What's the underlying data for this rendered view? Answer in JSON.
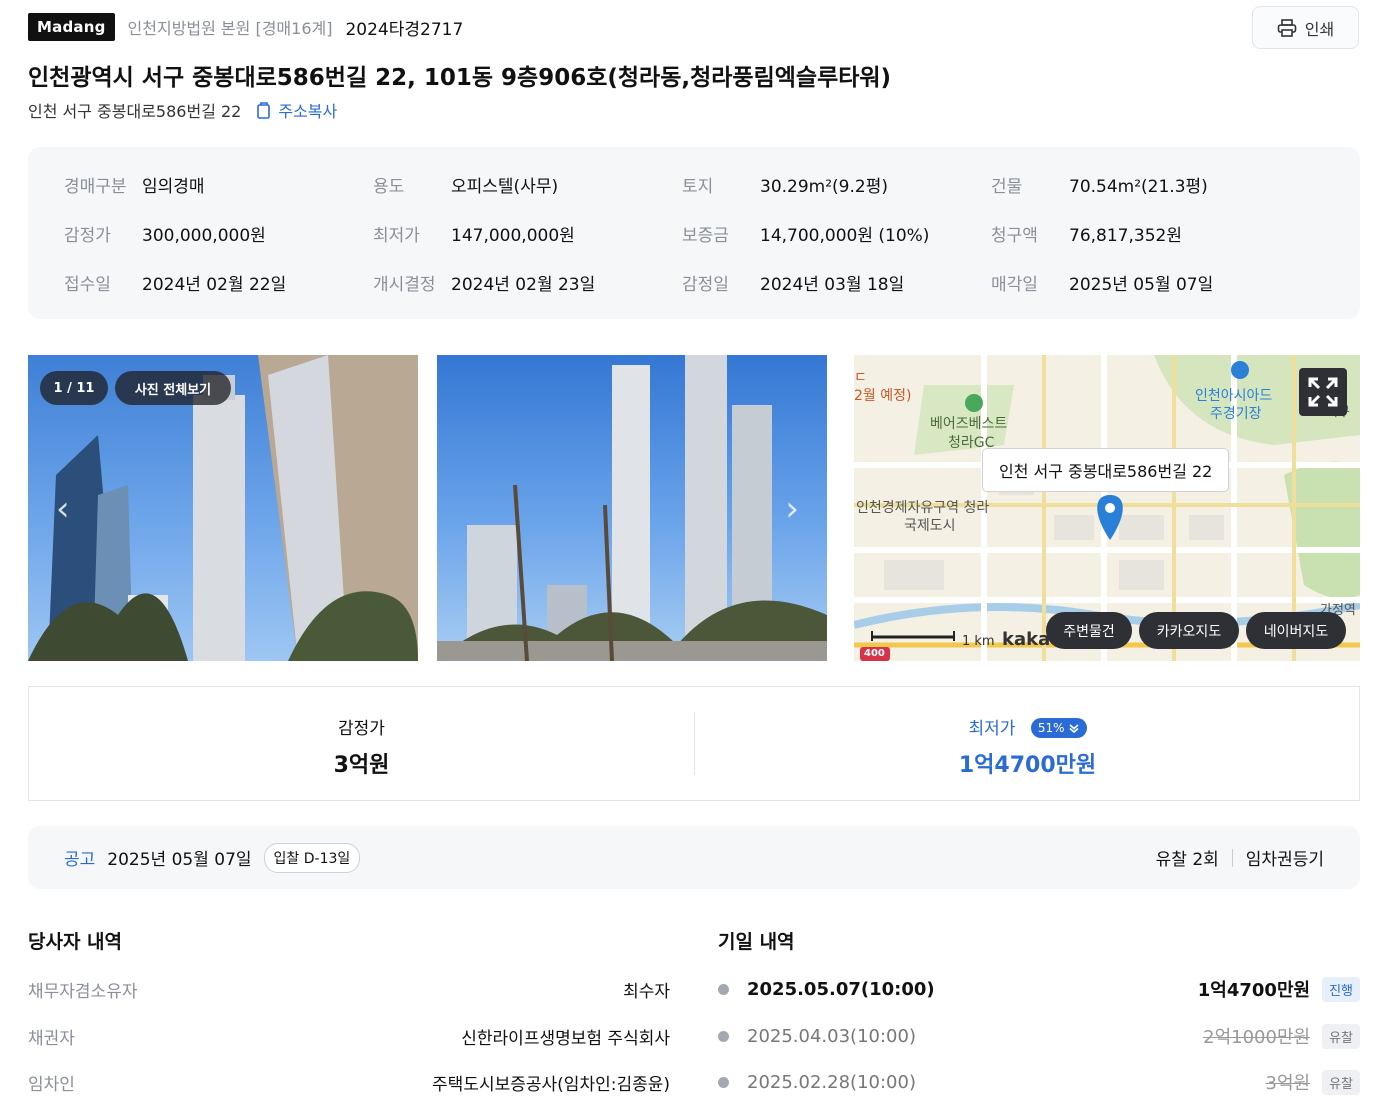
{
  "header": {
    "logo": "Madang",
    "court": "인천지방법원 본원 [경매16계]",
    "case_no": "2024타경2717",
    "print_label": "인쇄",
    "title": "인천광역시 서구 중봉대로586번길 22, 101동 9층906호(청라동,청라풍림엑슬루타워)",
    "short_address": "인천 서구 중봉대로586번길 22",
    "copy_label": "주소복사"
  },
  "info": [
    {
      "label": "경매구분",
      "value": "임의경매"
    },
    {
      "label": "용도",
      "value": "오피스텔(사무)"
    },
    {
      "label": "토지",
      "value": "30.29m²(9.2평)"
    },
    {
      "label": "건물",
      "value": "70.54m²(21.3평)"
    },
    {
      "label": "감정가",
      "value": "300,000,000원"
    },
    {
      "label": "최저가",
      "value": "147,000,000원"
    },
    {
      "label": "보증금",
      "value": "14,700,000원 (10%)"
    },
    {
      "label": "청구액",
      "value": "76,817,352원"
    },
    {
      "label": "접수일",
      "value": "2024년 02월 22일"
    },
    {
      "label": "개시결정",
      "value": "2024년 02월 23일"
    },
    {
      "label": "감정일",
      "value": "2024년 03월 18일"
    },
    {
      "label": "매각일",
      "value": "2025년 05월 07일"
    }
  ],
  "gallery": {
    "counter": "1 / 11",
    "view_all": "사진 전체보기"
  },
  "map": {
    "labels": {
      "l1": "2월 예정)",
      "l2": "베어즈베스트",
      "l3": "청라GC",
      "l4": "인천아시아드",
      "l5": "주경기장",
      "l6": "인천경제자유구역 청라",
      "l7": "국제도시",
      "l8": "서구",
      "l9": "가정역",
      "l10": "ㄷ"
    },
    "tooltip": "인천 서구 중봉대로586번길 22",
    "scale": "1 km",
    "brand": "kakao",
    "route_no": "400",
    "buttons": [
      "주변물건",
      "카카오지도",
      "네이버지도"
    ]
  },
  "price": {
    "appraisal_label": "감정가",
    "appraisal_value": "3억원",
    "min_label": "최저가",
    "min_percent": "51%",
    "min_value": "1억4700만원"
  },
  "notice": {
    "label": "공고",
    "date": "2025년 05월 07일",
    "dday": "입찰 D-13일",
    "fail_count": "유찰 2회",
    "lease_reg": "임차권등기"
  },
  "parties": {
    "title": "당사자 내역",
    "rows": [
      {
        "label": "채무자겸소유자",
        "value": "최수자"
      },
      {
        "label": "채권자",
        "value": "신한라이프생명보험 주식회사"
      },
      {
        "label": "임차인",
        "value": "주택도시보증공사(임차인:김종윤)"
      }
    ]
  },
  "history": {
    "title": "기일 내역",
    "rows": [
      {
        "date": "2025.05.07(10:00)",
        "amount": "1억4700만원",
        "status": "진행"
      },
      {
        "date": "2025.04.03(10:00)",
        "amount": "2억1000만원",
        "status": "유찰"
      },
      {
        "date": "2025.02.28(10:00)",
        "amount": "3억원",
        "status": "유찰"
      }
    ]
  },
  "colors": {
    "accent": "#2a6bd8",
    "muted": "#8a8f99",
    "panel": "#f6f7f9"
  }
}
